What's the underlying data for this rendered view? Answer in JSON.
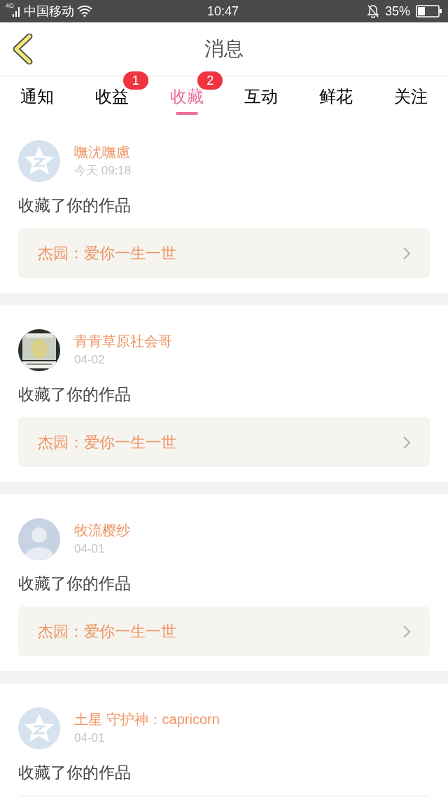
{
  "status_bar": {
    "network": "4G",
    "carrier": "中国移动",
    "time": "10:47",
    "battery": "35%"
  },
  "header": {
    "title": "消息"
  },
  "tabs": [
    {
      "label": "通知",
      "selected": false
    },
    {
      "label": "收益",
      "selected": false,
      "badge": "1"
    },
    {
      "label": "收藏",
      "selected": true,
      "badge": "2"
    },
    {
      "label": "互动",
      "selected": false
    },
    {
      "label": "鲜花",
      "selected": false
    },
    {
      "label": "关注",
      "selected": false
    }
  ],
  "messages": [
    {
      "avatar": {
        "kind": "star"
      },
      "name": "嘸沋嘸慮",
      "time": "今天 09:18",
      "action": "收藏了你的作品",
      "work": "杰园：爱你一生一世"
    },
    {
      "name": "青青草原社会哥",
      "time": "04-02",
      "action": "收藏了你的作品",
      "work": "杰园：爱你一生一世"
    },
    {
      "avatar": {
        "kind": "person"
      },
      "name": "牧流樱纱",
      "time": "04-01",
      "action": "收藏了你的作品",
      "work": "杰园：爱你一生一世"
    },
    {
      "avatar": {
        "kind": "star"
      },
      "name": "土星 守护神：capricorn",
      "time": "04-01",
      "action": "收藏了你的作品"
    }
  ]
}
